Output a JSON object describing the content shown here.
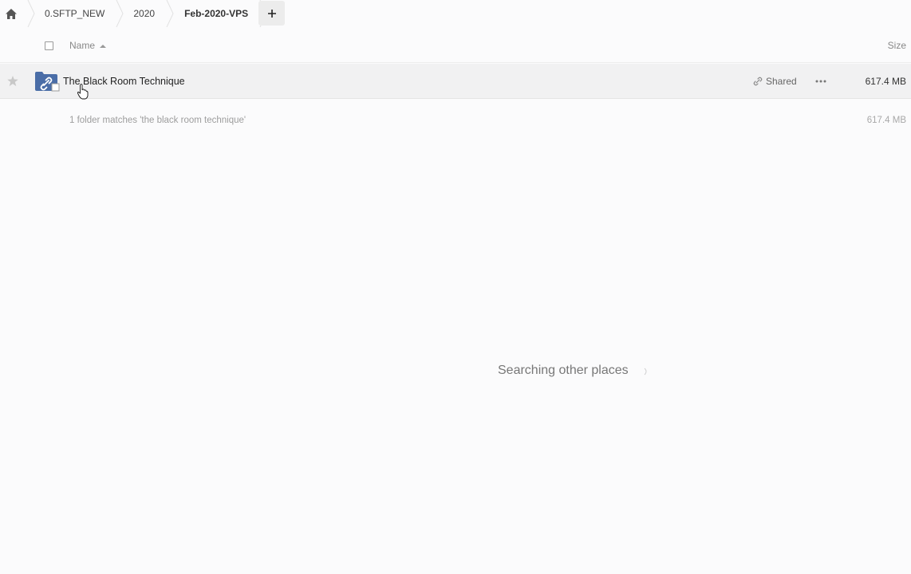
{
  "breadcrumb": {
    "home_icon": "home-icon",
    "items": [
      "0.SFTP_NEW",
      "2020",
      "Feb-2020-VPS"
    ],
    "add_label": "+"
  },
  "table_header": {
    "name_label": "Name",
    "size_label": "Size"
  },
  "files": [
    {
      "name": "The Black Room Technique",
      "shared_label": "Shared",
      "size": "617.4 MB",
      "icon": "shared-folder-icon"
    }
  ],
  "summary": {
    "text": "1 folder matches 'the black room technique'",
    "size": "617.4 MB"
  },
  "search_status": {
    "text": "Searching other places"
  },
  "colors": {
    "folder": "#4a6da7",
    "background": "#fbfbfc",
    "row_hover": "#f1f1f2"
  }
}
